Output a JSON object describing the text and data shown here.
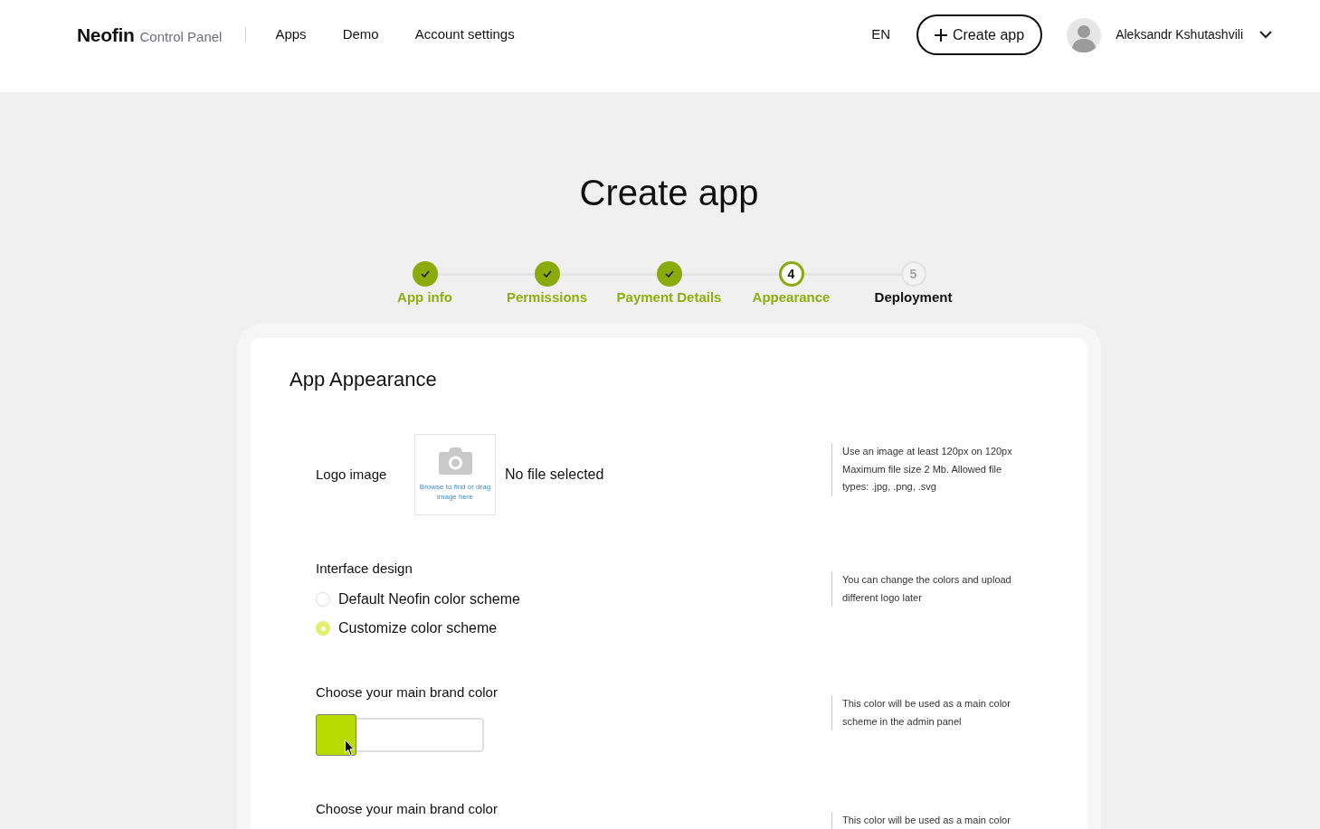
{
  "header": {
    "brand": "Neofin",
    "brand_sub": "Control Panel",
    "nav": [
      {
        "label": "Apps"
      },
      {
        "label": "Demo"
      },
      {
        "label": "Account settings"
      }
    ],
    "language": "EN",
    "create_button": "Create app",
    "user": {
      "name": "Aleksandr Kshutashvili"
    }
  },
  "page": {
    "title": "Create app"
  },
  "steps": [
    {
      "label": "App info",
      "done": true,
      "current": false
    },
    {
      "label": "Permissions",
      "done": true,
      "current": false
    },
    {
      "label": "Payment Details",
      "done": true,
      "current": false
    },
    {
      "label": "Appearance",
      "done": false,
      "current": true,
      "number": "4"
    },
    {
      "label": "Deployment",
      "done": false,
      "current": false,
      "number": "5"
    }
  ],
  "form": {
    "title": "App Appearance",
    "sections": [
      {
        "kind": "upload",
        "label": "Logo image",
        "drop_hint": "Browse to find or drag image here",
        "file_status": "No file selected",
        "help": "Use an image at least 120px on 120px Maximum file size 2 Mb. Allowed file types: .jpg, .png, .svg"
      },
      {
        "kind": "radio",
        "label": "Interface design",
        "options": [
          {
            "label": "Default Neofin color scheme",
            "selected": false
          },
          {
            "label": "Customize color scheme",
            "selected": true
          }
        ],
        "help": "You can change the colors and upload different logo later"
      },
      {
        "kind": "color",
        "label": "Choose your main brand color",
        "color": "#b9dc00",
        "help": "This color will be used as a main color scheme in the admin panel"
      },
      {
        "kind": "color",
        "label": "Choose your main brand color",
        "help": "This color will be used as a main color"
      }
    ]
  }
}
